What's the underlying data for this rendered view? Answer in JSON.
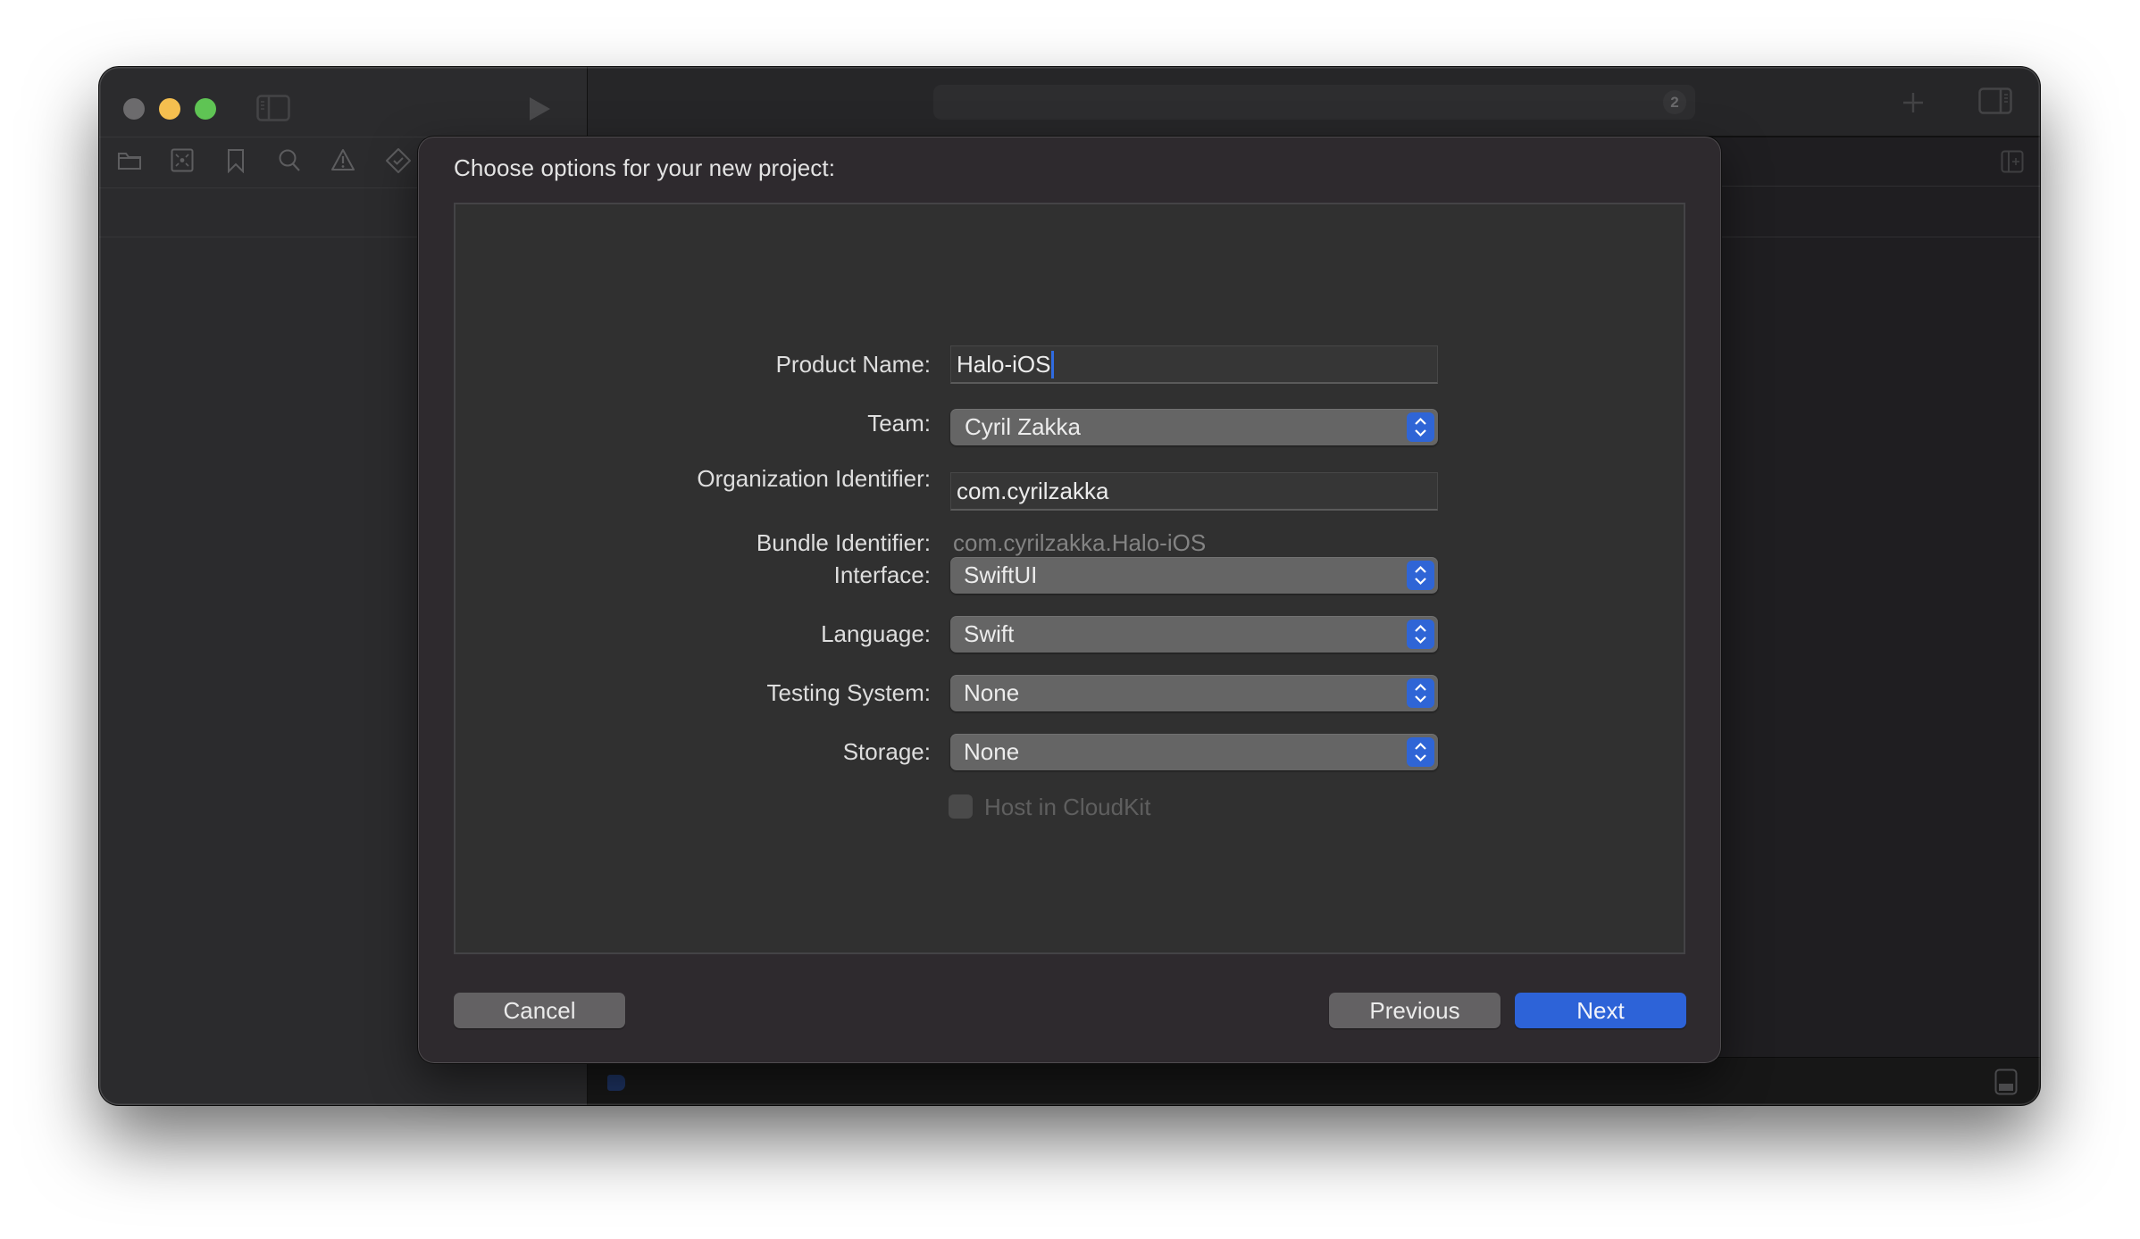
{
  "window": {
    "traffic_lights": [
      "close",
      "minimize",
      "zoom"
    ],
    "activity_viewer": {
      "badge_count": "2"
    },
    "toolbar_icons": [
      "sidebar-toggle-icon",
      "run-icon",
      "add-icon",
      "inspector-toggle-icon"
    ],
    "navigator_icons": [
      "folder-icon",
      "source-control-icon",
      "bookmark-icon",
      "search-icon",
      "warning-icon",
      "test-icon"
    ]
  },
  "dialog": {
    "title": "Choose options for your new project:",
    "fields": {
      "product_name": {
        "label": "Product Name:",
        "value": "Halo-iOS"
      },
      "team": {
        "label": "Team:",
        "value": "Cyril Zakka"
      },
      "organization_identifier": {
        "label": "Organization Identifier:",
        "value": "com.cyrilzakka"
      },
      "bundle_identifier": {
        "label": "Bundle Identifier:",
        "value": "com.cyrilzakka.Halo-iOS"
      },
      "interface": {
        "label": "Interface:",
        "value": "SwiftUI"
      },
      "language": {
        "label": "Language:",
        "value": "Swift"
      },
      "testing_system": {
        "label": "Testing System:",
        "value": "None"
      },
      "storage": {
        "label": "Storage:",
        "value": "None"
      },
      "host_in_cloudkit": {
        "label": "Host in CloudKit",
        "checked": false,
        "enabled": false
      }
    },
    "buttons": {
      "cancel": "Cancel",
      "previous": "Previous",
      "next": "Next"
    }
  },
  "colors": {
    "accent": "#2d63d8",
    "traffic_close": "#6c6b6d",
    "traffic_minimize": "#f5bf4f",
    "traffic_zoom": "#5fc454"
  }
}
